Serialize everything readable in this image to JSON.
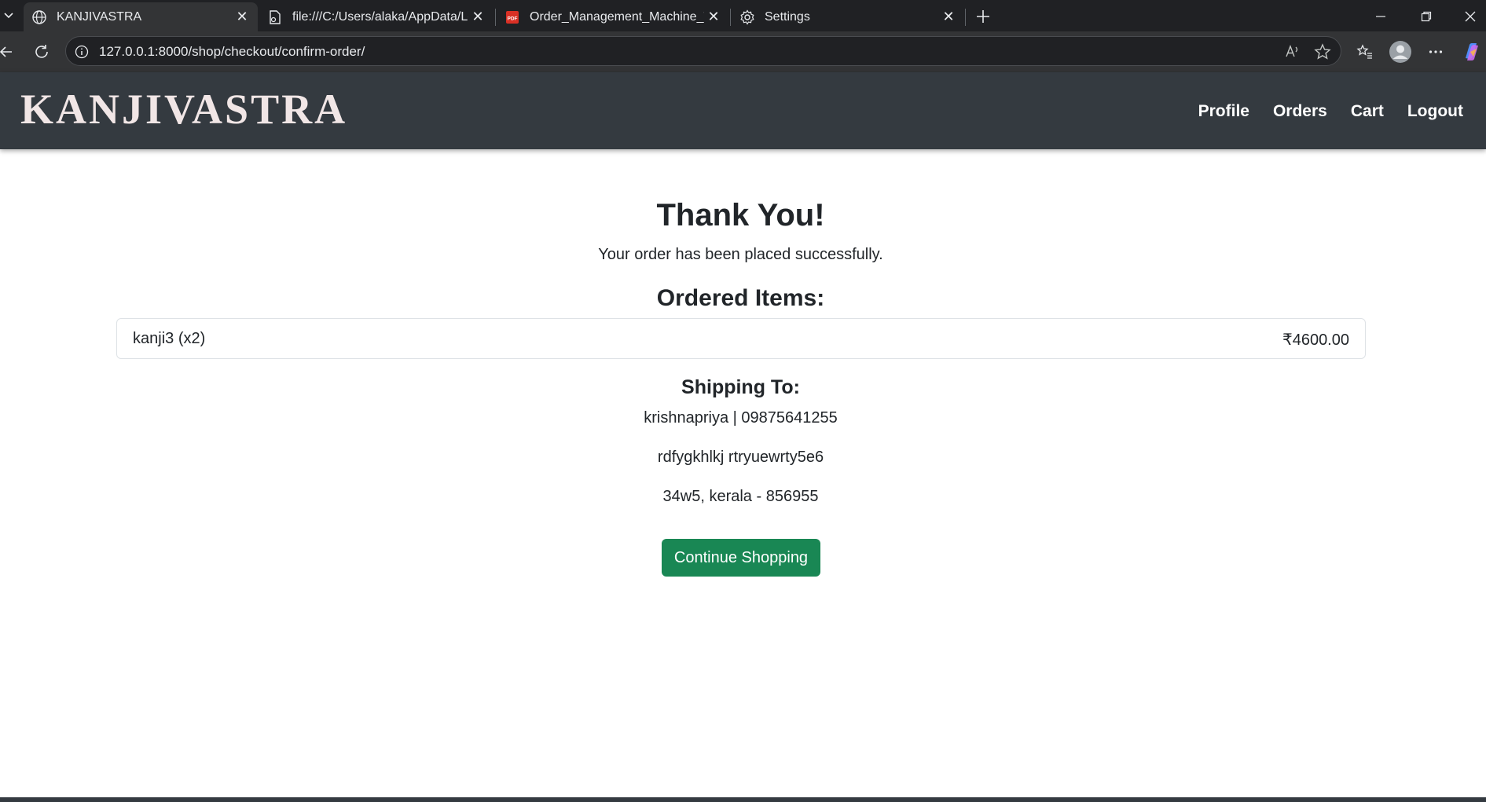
{
  "browser": {
    "tabs": [
      {
        "title": "KANJIVASTRA",
        "icon": "globe-icon",
        "active": true
      },
      {
        "title": "file:///C:/Users/alaka/AppData/Lo",
        "icon": "file-icon",
        "active": false
      },
      {
        "title": "Order_Management_Machine_Tes",
        "icon": "pdf-icon",
        "active": false
      },
      {
        "title": "Settings",
        "icon": "gear-icon",
        "active": false
      }
    ],
    "url": "127.0.0.1:8000/shop/checkout/confirm-order/",
    "pdf_badge": "PDF"
  },
  "site": {
    "brand": "KANJIVASTRA",
    "nav": [
      {
        "label": "Profile"
      },
      {
        "label": "Orders"
      },
      {
        "label": "Cart"
      },
      {
        "label": "Logout"
      }
    ]
  },
  "confirmation": {
    "title": "Thank You!",
    "message": "Your order has been placed successfully.",
    "items_heading": "Ordered Items:",
    "items": [
      {
        "name": "kanji3 (x2)",
        "price": "₹4600.00"
      }
    ],
    "shipping_heading": "Shipping To:",
    "shipping_lines": [
      "krishnapriya | 09875641255",
      "rdfygkhlkj rtryuewrty5e6",
      "34w5, kerala - 856955"
    ],
    "continue_label": "Continue Shopping"
  },
  "colors": {
    "browser_bg": "#202124",
    "nav_bg": "#343a40",
    "brand_color": "#f1e6e6",
    "button_green": "#198754"
  }
}
